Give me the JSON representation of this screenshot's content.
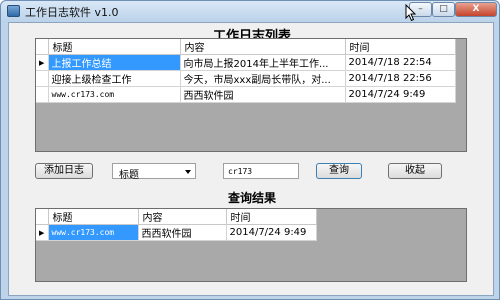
{
  "window": {
    "title": "工作日志软件 v1.0",
    "min": "–",
    "max": "□",
    "close": "X"
  },
  "log_list": {
    "heading": "工作日志列表",
    "columns": [
      "标题",
      "内容",
      "时间"
    ],
    "rows": [
      {
        "indicator": "▶",
        "title": "上报工作总结",
        "content": "向市局上报2014年上半年工作...",
        "time": "2014/7/18 22:54"
      },
      {
        "indicator": "",
        "title": "迎接上级检查工作",
        "content": "今天，市局xxx副局长带队，对...",
        "time": "2014/7/18 22:56"
      },
      {
        "indicator": "",
        "title": "www.cr173.com",
        "content": "西西软件园",
        "time": "2014/7/24 9:49"
      }
    ]
  },
  "controls": {
    "add_label": "添加日志",
    "field_select": "标题",
    "search_value": "cr173",
    "query_label": "查询",
    "collapse_label": "收起"
  },
  "results": {
    "heading": "查询结果",
    "columns": [
      "标题",
      "内容",
      "时间"
    ],
    "rows": [
      {
        "indicator": "▶",
        "title": "www.cr173.com",
        "content": "西西软件园",
        "time": "2014/7/24 9:49"
      }
    ]
  }
}
